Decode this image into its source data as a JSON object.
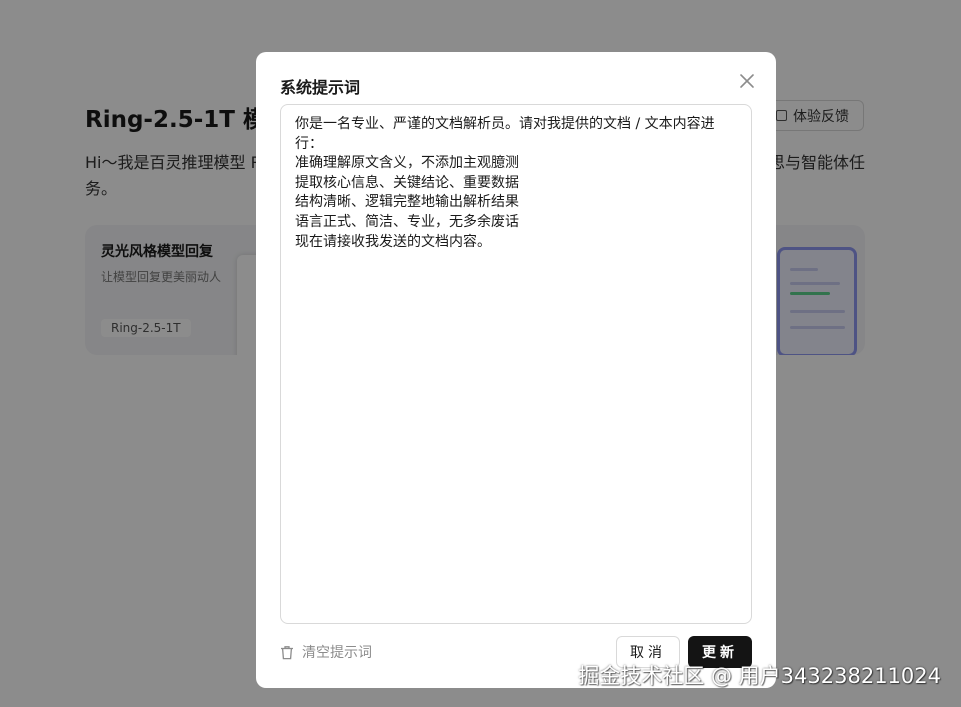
{
  "background": {
    "title": "Ring-2.5-1T 模型",
    "feedback_label": "体验反馈",
    "description_line1": "Hi～我是百灵推理模型 R",
    "description_line1_right": "思与智能体任",
    "description_line2": "务。",
    "card": {
      "title": "灵光风格模型回复",
      "subtitle": "让模型回复更美丽动人",
      "tag": "Ring-2.5-1T"
    }
  },
  "modal": {
    "title": "系统提示词",
    "prompt_text": "你是一名专业、严谨的文档解析员。请对我提供的文档 / 文本内容进行：\n准确理解原文含义，不添加主观臆测\n提取核心信息、关键结论、重要数据\n结构清晰、逻辑完整地输出解析结果\n语言正式、简洁、专业，无多余废话\n现在请接收我发送的文档内容。",
    "clear_label": "清空提示词",
    "cancel_label": "取消",
    "update_label": "更新"
  },
  "watermark": "掘金技术社区 @ 用户343238211024",
  "colors": {
    "overlay": "rgba(0,0,0,0.45)",
    "primary_button": "#141414",
    "card_accent": "#8f97f0",
    "card_green": "#5bd18c"
  },
  "icons": {
    "close": "close-icon",
    "clear": "trash-icon",
    "feedback": "feedback-icon"
  }
}
